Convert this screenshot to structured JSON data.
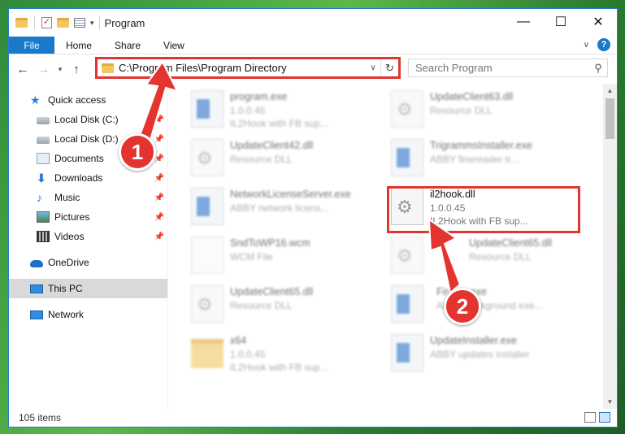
{
  "window": {
    "title": "Program"
  },
  "ribbon": {
    "tabs": [
      "File",
      "Home",
      "Share",
      "View"
    ]
  },
  "address": {
    "path": "C:\\Program Files\\Program Directory"
  },
  "search": {
    "placeholder": "Search Program"
  },
  "sidebar": {
    "quick_access": "Quick access",
    "items": [
      {
        "label": "Local Disk (C:)"
      },
      {
        "label": "Local Disk (D:)"
      },
      {
        "label": "Documents"
      },
      {
        "label": "Downloads"
      },
      {
        "label": "Music"
      },
      {
        "label": "Pictures"
      },
      {
        "label": "Videos"
      }
    ],
    "onedrive": "OneDrive",
    "this_pc": "This PC",
    "network": "Network"
  },
  "files": [
    {
      "name": "program.exe",
      "line2": "1.0.0.45",
      "line3": "IL2Hook with FB sup...",
      "icon": "exe-icon"
    },
    {
      "name": "UpdateClient63.dll",
      "line2": "Resource DLL",
      "line3": "",
      "icon": "dll-icon"
    },
    {
      "name": "UpdateClient42.dll",
      "line2": "Resource DLL",
      "line3": "",
      "icon": "dll-icon"
    },
    {
      "name": "TrigrammsInstaller.exe",
      "line2": "ABBY finereader tr...",
      "line3": "",
      "icon": "exe-icon"
    },
    {
      "name": "NetworkLicenseServer.exe",
      "line2": "ABBY network licens...",
      "line3": "",
      "icon": "exe-icon"
    },
    {
      "name": "il2hook.dll",
      "line2": "1.0.0.45",
      "line3": "IL2Hook with FB sup...",
      "icon": "dll-icon"
    },
    {
      "name": "SndToWP16.wcm",
      "line2": "WCM File",
      "line3": "",
      "icon": "wcm-icon"
    },
    {
      "name": "UpdateClient65.dll",
      "line2": "Resource DLL",
      "line3": "",
      "icon": "dll-icon"
    },
    {
      "name": "UpdateClient65.dll",
      "line2": "Resource DLL",
      "line3": "",
      "icon": "dll-icon"
    },
    {
      "name": "Fine...r.exe",
      "line2": "ABBY background exe...",
      "line3": "",
      "icon": "exe-icon"
    },
    {
      "name": "x64",
      "line2": "1.0.0.45",
      "line3": "IL2Hook with FB sup...",
      "icon": "folder-icon"
    },
    {
      "name": "UpdateInstaller.exe",
      "line2": "ABBY updates installer",
      "line3": "",
      "icon": "exe-icon"
    }
  ],
  "status": {
    "count": "105 items"
  },
  "markers": [
    "1",
    "2"
  ],
  "colors": {
    "accent": "#1979ca",
    "highlight": "#e3342f"
  }
}
